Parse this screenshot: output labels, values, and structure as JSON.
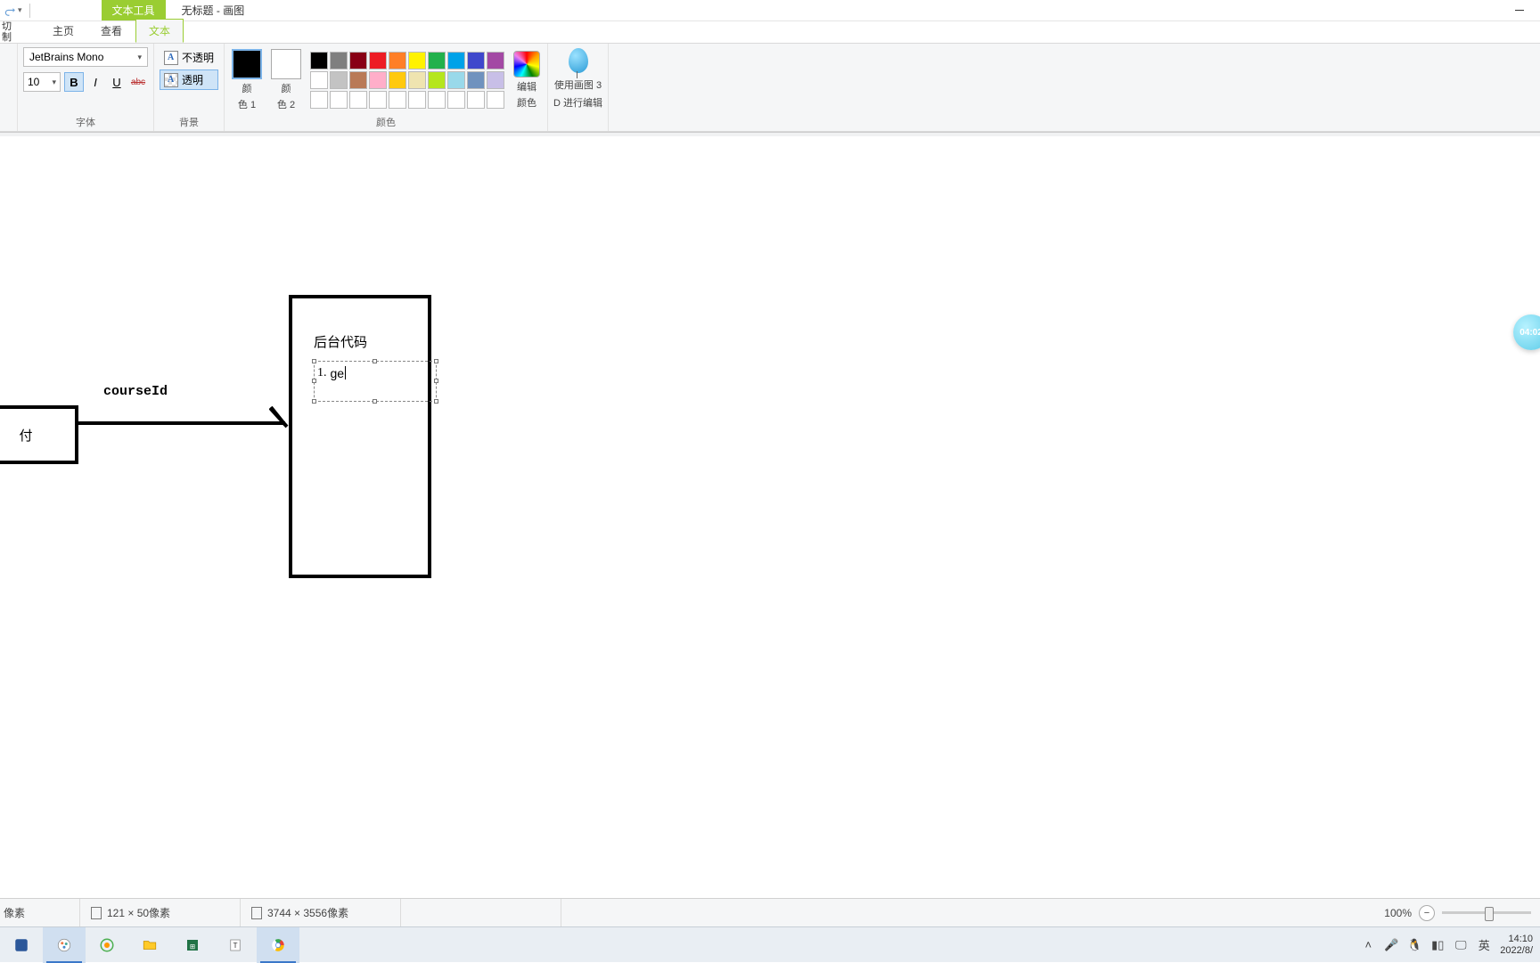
{
  "titlebar": {
    "context_tab": "文本工具",
    "title": "无标题 - 画图"
  },
  "tabs": {
    "clipboard_cut": "切",
    "clipboard_copy": "制",
    "home": "主页",
    "view": "查看",
    "text": "文本"
  },
  "ribbon": {
    "font_group_label": "字体",
    "font_name": "JetBrains Mono",
    "font_size": "10",
    "bold": "B",
    "italic": "I",
    "underline": "U",
    "strike": "abc",
    "bg_group_label": "背景",
    "bg_opaque": "不透明",
    "bg_transparent": "透明",
    "color1_line1": "颜",
    "color1_line2": "色 1",
    "color2_line1": "颜",
    "color2_line2": "色 2",
    "edit_colors_line1": "编辑",
    "edit_colors_line2": "颜色",
    "colors_group_label": "颜色",
    "p3d_line1": "使用画图 3",
    "p3d_line2": "D 进行编辑",
    "palette_row1": [
      "#000000",
      "#7f7f7f",
      "#880015",
      "#ed1c24",
      "#ff7f27",
      "#fff200",
      "#22b14c",
      "#00a2e8",
      "#3f48cc",
      "#a349a4"
    ],
    "palette_row2": [
      "#ffffff",
      "#c3c3c3",
      "#b97a57",
      "#ffaec9",
      "#ffc90e",
      "#efe4b0",
      "#b5e61d",
      "#99d9ea",
      "#7092be",
      "#c8bfe7"
    ],
    "palette_row3": [
      "#ffffff",
      "#ffffff",
      "#ffffff",
      "#ffffff",
      "#ffffff",
      "#ffffff",
      "#ffffff",
      "#ffffff",
      "#ffffff",
      "#ffffff"
    ]
  },
  "canvas": {
    "left_box_text": "付",
    "arrow_label": "courseId",
    "right_box_title": "后台代码",
    "text_edit_num": "1.",
    "text_edit_value": "ge"
  },
  "float_bubble": "04:02",
  "status": {
    "cursor_unit": "像素",
    "selection": "121 × 50像素",
    "canvas_size": "3744 × 3556像素",
    "zoom": "100%"
  },
  "taskbar": {
    "ime": "英",
    "time": "14:10",
    "date": "2022/8/"
  },
  "icons": {
    "gradient": "conic-gradient(red,orange,yellow,green,cyan,blue,violet,red)"
  }
}
